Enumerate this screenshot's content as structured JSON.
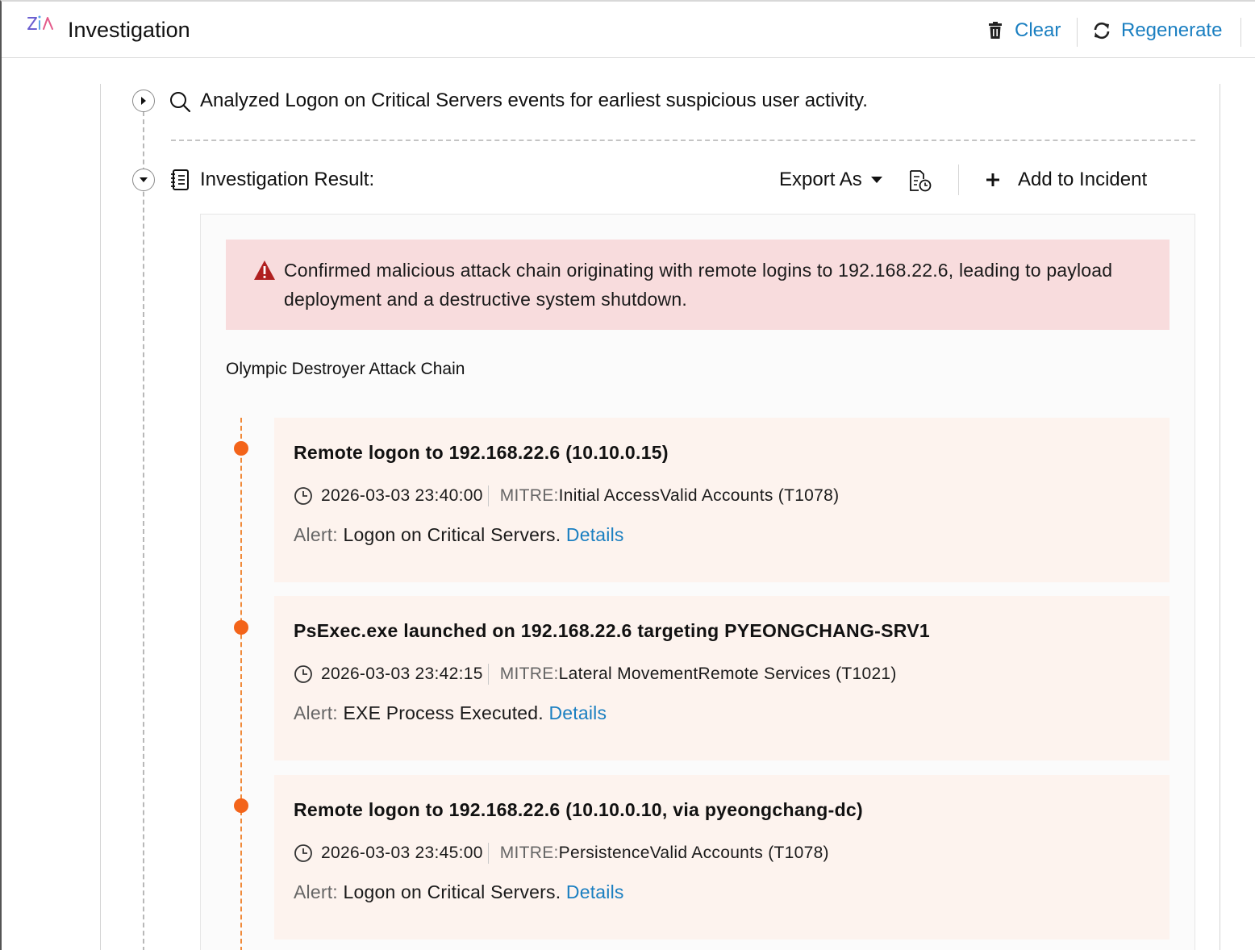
{
  "header": {
    "title": "Investigation",
    "clear_label": "Clear",
    "regenerate_label": "Regenerate"
  },
  "steps": [
    {
      "text": "Analyzed Logon on Critical Servers events for earliest suspicious user activity."
    }
  ],
  "result": {
    "title": "Investigation Result:",
    "export_label": "Export As",
    "add_incident_label": "Add to Incident",
    "alert": "Confirmed malicious attack chain originating with remote logins to 192.168.22.6, leading to payload deployment and a destructive system shutdown.",
    "chain_title": "Olympic Destroyer Attack Chain",
    "events": [
      {
        "title": "Remote logon to 192.168.22.6 (10.10.0.15)",
        "time": "2026-03-03 23:40:00",
        "mitre_label": "MITRE:",
        "mitre_value": "Initial AccessValid Accounts (T1078)",
        "alert_label": "Alert:",
        "alert_value": "Logon on Critical Servers.",
        "details_label": "Details"
      },
      {
        "title": "PsExec.exe launched on 192.168.22.6 targeting PYEONGCHANG-SRV1",
        "time": "2026-03-03 23:42:15",
        "mitre_label": "MITRE:",
        "mitre_value": "Lateral MovementRemote Services (T1021)",
        "alert_label": "Alert:",
        "alert_value": "EXE Process Executed.",
        "details_label": "Details"
      },
      {
        "title": "Remote logon to 192.168.22.6 (10.10.0.10, via pyeongchang-dc)",
        "time": "2026-03-03 23:45:00",
        "mitre_label": "MITRE:",
        "mitre_value": "PersistenceValid Accounts (T1078)",
        "alert_label": "Alert:",
        "alert_value": "Logon on Critical Servers.",
        "details_label": "Details"
      }
    ]
  },
  "colors": {
    "link": "#1a7fc1",
    "alert_bg": "#f8dcdd",
    "alert_icon": "#b02020",
    "timeline": "#f3641a",
    "card_bg": "#fdf3ee"
  },
  "icons": {
    "logo": "zia-logo-icon",
    "clear": "trash-icon",
    "regenerate": "refresh-icon",
    "step": "search-icon",
    "result": "notebook-icon",
    "export": "caret-down-icon",
    "schedule": "scheduled-report-icon",
    "add": "plus-icon",
    "alert": "warning-icon",
    "time": "clock-icon"
  }
}
